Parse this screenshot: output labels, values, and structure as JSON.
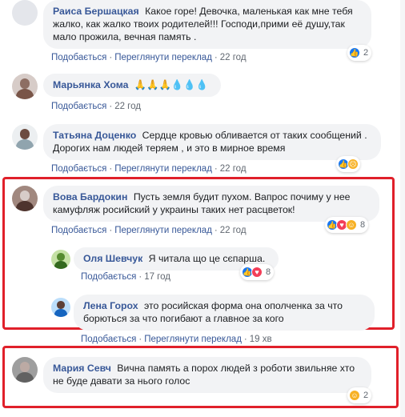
{
  "labels": {
    "like": "Подобається",
    "translate": "Переглянути переклад",
    "separator": "·"
  },
  "comments": [
    {
      "author": "Раиса Бершацкая",
      "text": "Какое горе! Девочка, маленькая как мне тебя жалко, как жалко твоих родителей!!! Господи,прими её душу,так мало прожила, вечная память .",
      "time": "22 год",
      "reactions": {
        "icons": [
          "like"
        ],
        "count": "2"
      }
    },
    {
      "author": "Марьянка Хома",
      "text": "🙏🙏🙏💧💧💧",
      "time": "22 год"
    },
    {
      "author": "Татьяна Доценко",
      "text": "Сердце кровью обливается от таких сообщений . Дорогих нам людей теряем , и это в мирное время",
      "time": "22 год",
      "reactions": {
        "icons": [
          "like",
          "sad"
        ],
        "count": ""
      }
    },
    {
      "author": "Вова Бардокин",
      "text": "Пусть земля будит пухом. Вапрос почиму у нее камуфляж росийский у украины таких нет расцветок!",
      "time": "22 год",
      "reactions": {
        "icons": [
          "like",
          "love",
          "haha"
        ],
        "count": "8"
      }
    },
    {
      "author": "Оля Шевчук",
      "text": "Я читала що це сєпарша.",
      "time": "17 год",
      "reactions": {
        "icons": [
          "like",
          "love"
        ],
        "count": "8"
      }
    },
    {
      "author": "Лена Горох",
      "text": "это росийская форма она ополченка за что борються за что погибают а главное за кого",
      "time": "19 хв"
    },
    {
      "author": "Мария Севч",
      "text": "Вична память а порох людей з роботи звильняе хто не буде давати за нього голос",
      "reactions": {
        "icons": [
          "haha"
        ],
        "count": "2"
      }
    }
  ],
  "colors": {
    "author": "#385898",
    "bubble": "#f2f3f5",
    "highlight": "#e0202a",
    "meta": "#606770"
  }
}
